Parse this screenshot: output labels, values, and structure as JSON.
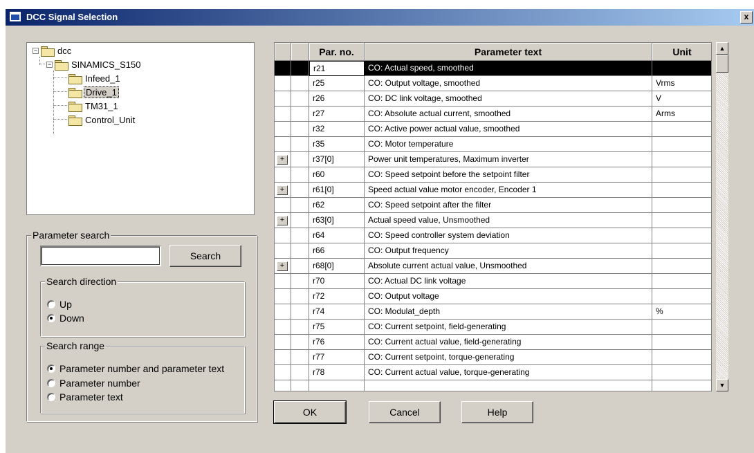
{
  "window": {
    "title": "DCC Signal Selection",
    "close_label": "x"
  },
  "tree": {
    "root": "dcc",
    "device": "SINAMICS_S150",
    "children": [
      "Infeed_1",
      "Drive_1",
      "TM31_1",
      "Control_Unit"
    ],
    "selected": "Drive_1",
    "collapse_glyph": "−"
  },
  "search": {
    "group_label": "Parameter search",
    "input_value": "",
    "button_label": "Search",
    "direction": {
      "label": "Search direction",
      "options": [
        "Up",
        "Down"
      ],
      "selected": "Down"
    },
    "range": {
      "label": "Search range",
      "options": [
        "Parameter number and parameter text",
        "Parameter number",
        "Parameter text"
      ],
      "selected": "Parameter number and parameter text"
    }
  },
  "table": {
    "columns": [
      "",
      "",
      "Par. no.",
      "Parameter text",
      "Unit"
    ],
    "expand_glyph": "+",
    "rows": [
      {
        "expand": false,
        "par": "r21",
        "text": "CO: Actual speed, smoothed",
        "unit": "",
        "selected": true
      },
      {
        "expand": false,
        "par": "r25",
        "text": "CO: Output voltage, smoothed",
        "unit": "Vrms"
      },
      {
        "expand": false,
        "par": "r26",
        "text": "CO: DC link voltage, smoothed",
        "unit": "V"
      },
      {
        "expand": false,
        "par": "r27",
        "text": "CO: Absolute actual current, smoothed",
        "unit": "Arms"
      },
      {
        "expand": false,
        "par": "r32",
        "text": "CO: Active power actual value, smoothed",
        "unit": ""
      },
      {
        "expand": false,
        "par": "r35",
        "text": "CO: Motor temperature",
        "unit": ""
      },
      {
        "expand": true,
        "par": "r37[0]",
        "text": "Power unit temperatures, Maximum inverter",
        "unit": ""
      },
      {
        "expand": false,
        "par": "r60",
        "text": "CO: Speed setpoint before the setpoint filter",
        "unit": ""
      },
      {
        "expand": true,
        "par": "r61[0]",
        "text": "Speed actual value motor encoder, Encoder 1",
        "unit": ""
      },
      {
        "expand": false,
        "par": "r62",
        "text": "CO: Speed setpoint after the filter",
        "unit": ""
      },
      {
        "expand": true,
        "par": "r63[0]",
        "text": "Actual speed value, Unsmoothed",
        "unit": ""
      },
      {
        "expand": false,
        "par": "r64",
        "text": "CO: Speed controller system deviation",
        "unit": ""
      },
      {
        "expand": false,
        "par": "r66",
        "text": "CO: Output frequency",
        "unit": ""
      },
      {
        "expand": true,
        "par": "r68[0]",
        "text": "Absolute current actual value, Unsmoothed",
        "unit": ""
      },
      {
        "expand": false,
        "par": "r70",
        "text": "CO: Actual DC link voltage",
        "unit": ""
      },
      {
        "expand": false,
        "par": "r72",
        "text": "CO: Output voltage",
        "unit": ""
      },
      {
        "expand": false,
        "par": "r74",
        "text": "CO: Modulat_depth",
        "unit": "%"
      },
      {
        "expand": false,
        "par": "r75",
        "text": "CO: Current setpoint, field-generating",
        "unit": ""
      },
      {
        "expand": false,
        "par": "r76",
        "text": "CO: Current actual value, field-generating",
        "unit": ""
      },
      {
        "expand": false,
        "par": "r77",
        "text": "CO: Current setpoint, torque-generating",
        "unit": ""
      },
      {
        "expand": false,
        "par": "r78",
        "text": "CO: Current actual value, torque-generating",
        "unit": ""
      },
      {
        "expand": false,
        "par": "",
        "text": "",
        "unit": ""
      }
    ]
  },
  "scrollbar": {
    "up_glyph": "▲",
    "down_glyph": "▼"
  },
  "buttons": {
    "ok": "OK",
    "cancel": "Cancel",
    "help": "Help"
  }
}
